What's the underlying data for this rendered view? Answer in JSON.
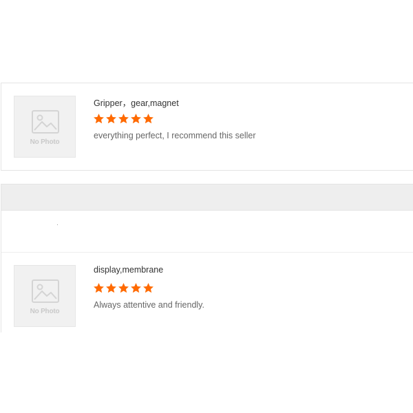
{
  "reviews": [
    {
      "product": "Gripper，gear,magnet",
      "rating": 5,
      "comment": "everything perfect, I recommend this seller",
      "thumbnail_label": "No Photo"
    },
    {
      "product": "display,membrane",
      "rating": 5,
      "comment": "Always attentive and friendly.",
      "thumbnail_label": "No Photo"
    }
  ],
  "colors": {
    "star": "#ff6a00",
    "placeholder_bg": "#f1f1f1",
    "header_bg": "#eeeeee"
  },
  "icons": {
    "thumbnail": "image-placeholder-icon",
    "star": "star-icon"
  }
}
